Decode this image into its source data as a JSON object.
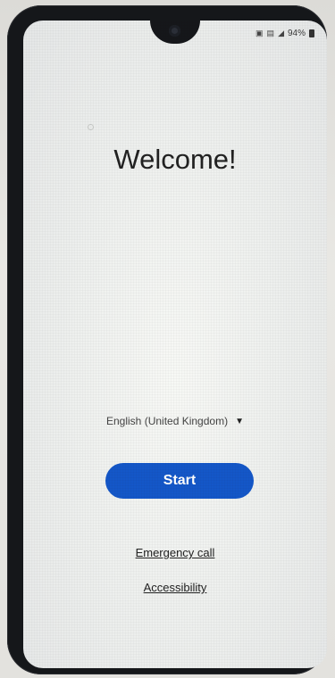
{
  "status_bar": {
    "icons": [
      "nfc-icon",
      "sim-icon",
      "signal-icon"
    ],
    "battery": "94%"
  },
  "welcome": {
    "title": "Welcome!"
  },
  "language": {
    "selected": "English (United Kingdom)"
  },
  "start_button": {
    "label": "Start"
  },
  "links": {
    "emergency": "Emergency call",
    "accessibility": "Accessibility"
  },
  "colors": {
    "accent": "#1457c8",
    "text": "#222222",
    "bezel": "#15171a"
  }
}
